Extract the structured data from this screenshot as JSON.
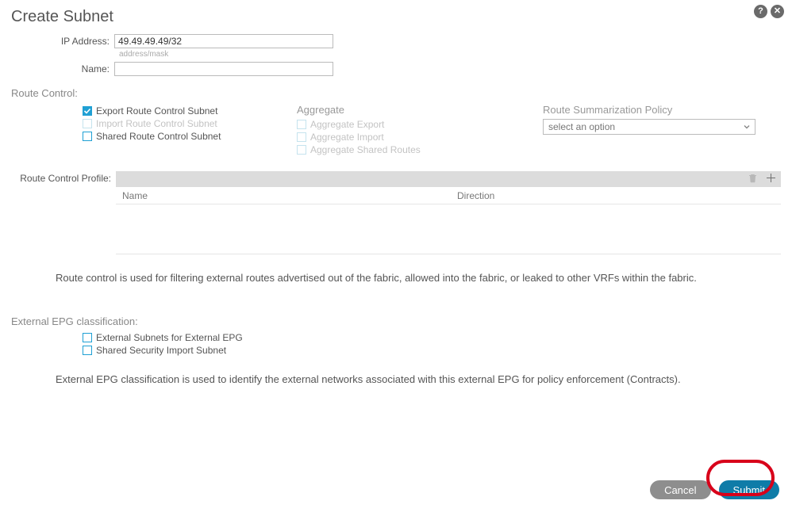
{
  "title": "Create Subnet",
  "header": {
    "help_glyph": "?",
    "close_glyph": "✕"
  },
  "fields": {
    "ip_label": "IP Address:",
    "ip_value": "49.49.49.49/32",
    "ip_hint": "address/mask",
    "name_label": "Name:",
    "name_value": ""
  },
  "route_control": {
    "title": "Route Control:",
    "checks": [
      {
        "label": "Export Route Control Subnet",
        "checked": true,
        "disabled": false
      },
      {
        "label": "Import Route Control Subnet",
        "checked": false,
        "disabled": true
      },
      {
        "label": "Shared Route Control Subnet",
        "checked": false,
        "disabled": false
      }
    ],
    "aggregate": {
      "title": "Aggregate",
      "checks": [
        {
          "label": "Aggregate Export",
          "checked": false,
          "disabled": true
        },
        {
          "label": "Aggregate Import",
          "checked": false,
          "disabled": true
        },
        {
          "label": "Aggregate Shared Routes",
          "checked": false,
          "disabled": true
        }
      ]
    },
    "summarization": {
      "title": "Route Summarization Policy",
      "selected": "select an option"
    },
    "profile": {
      "label": "Route Control Profile:",
      "columns": {
        "name": "Name",
        "direction": "Direction"
      }
    },
    "description": "Route control is used for filtering external routes advertised out of the fabric, allowed into the fabric, or leaked to other VRFs within the fabric."
  },
  "epg": {
    "title": "External EPG classification:",
    "checks": [
      {
        "label": "External Subnets for External EPG",
        "checked": false
      },
      {
        "label": "Shared Security Import Subnet",
        "checked": false
      }
    ],
    "description": "External EPG classification is used to identify the external networks associated with this external EPG for policy enforcement (Contracts)."
  },
  "footer": {
    "cancel": "Cancel",
    "submit": "Submit"
  }
}
